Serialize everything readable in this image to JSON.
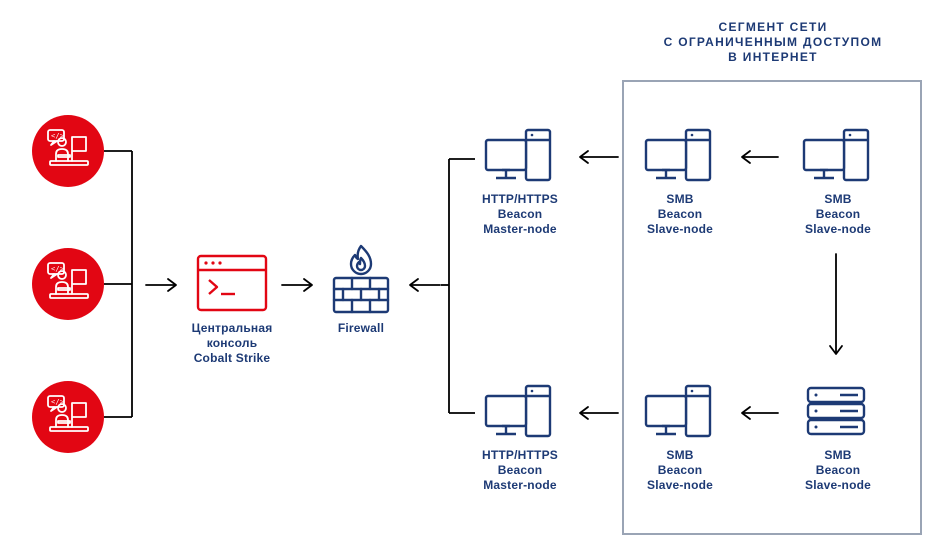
{
  "header": "СЕГМЕНТ СЕТИ\nС ОГРАНИЧЕННЫМ ДОСТУПОМ\nВ ИНТЕРНЕТ",
  "labels": {
    "console": "Центральная\nконсоль\nCobalt Strike",
    "firewall": "Firewall",
    "master1": "HTTP/HTTPS\nBeacon\nMaster-node",
    "master2": "HTTP/HTTPS\nBeacon\nMaster-node",
    "slave_top1": "SMB\nBeacon\nSlave-node",
    "slave_top2": "SMB\nBeacon\nSlave-node",
    "slave_bot1": "SMB\nBeacon\nSlave-node",
    "slave_bot2": "SMB\nBeacon\nSlave-node"
  },
  "icons": {
    "attacker": "attacker-person-icon",
    "console": "terminal-icon",
    "firewall": "firewall-icon",
    "workstation": "workstation-icon",
    "server": "server-rack-icon",
    "arrow": "arrow-icon"
  }
}
